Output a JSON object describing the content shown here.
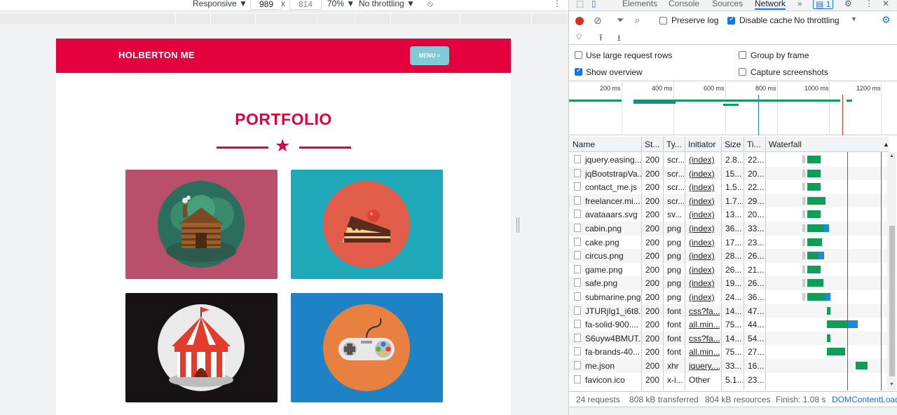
{
  "device_toolbar": {
    "device": "Responsive ▼",
    "width": "989",
    "times": "x",
    "height": "814",
    "zoom": "70% ▼",
    "throttle": "No throttling ▼"
  },
  "page": {
    "brand": "HOLBERTON ME",
    "menu": "MENU ≡",
    "section_title": "PORTFOLIO",
    "tiles": [
      {
        "name": "cabin",
        "color": "#b84f6b"
      },
      {
        "name": "cake",
        "color": "#1fa8b8"
      },
      {
        "name": "circus",
        "color": "#171314"
      },
      {
        "name": "game",
        "color": "#1d83c6"
      }
    ]
  },
  "devtools": {
    "tabs": [
      "Elements",
      "Console",
      "Sources",
      "Network"
    ],
    "active_tab": "Network",
    "more": "»",
    "issues_badge": "1",
    "toolbar": {
      "preserve_log": "Preserve log",
      "disable_cache": "Disable cache",
      "throttling": "No throttling"
    },
    "settings": {
      "large_rows": "Use large request rows",
      "group_by_frame": "Group by frame",
      "show_overview": "Show overview",
      "capture_screenshots": "Capture screenshots"
    },
    "overview_ticks": [
      "200 ms",
      "400 ms",
      "600 ms",
      "800 ms",
      "1000 ms",
      "1200 ms"
    ],
    "columns": [
      "Name",
      "St...",
      "Ty...",
      "Initiator",
      "Size",
      "Ti...",
      "Waterfall"
    ],
    "rows": [
      {
        "name": "jquery.easing....",
        "status": "200",
        "type": "scr...",
        "initiator": "(index)",
        "size": "2.8...",
        "time": "22...",
        "start": 0.16,
        "wait": 0.02,
        "recv": 0.12,
        "blue": 0.0
      },
      {
        "name": "jqBootstrapVa...",
        "status": "200",
        "type": "scr...",
        "initiator": "(index)",
        "size": "15...",
        "time": "20...",
        "start": 0.16,
        "wait": 0.02,
        "recv": 0.12,
        "blue": 0.0
      },
      {
        "name": "contact_me.js",
        "status": "200",
        "type": "scr...",
        "initiator": "(index)",
        "size": "1.5...",
        "time": "22...",
        "start": 0.16,
        "wait": 0.02,
        "recv": 0.12,
        "blue": 0.0
      },
      {
        "name": "freelancer.mi...",
        "status": "200",
        "type": "scr...",
        "initiator": "(index)",
        "size": "1.7...",
        "time": "29...",
        "start": 0.16,
        "wait": 0.02,
        "recv": 0.16,
        "blue": 0.0
      },
      {
        "name": "avataaars.svg",
        "status": "200",
        "type": "sv...",
        "initiator": "(index)",
        "size": "13...",
        "time": "20...",
        "start": 0.16,
        "wait": 0.02,
        "recv": 0.12,
        "blue": 0.0
      },
      {
        "name": "cabin.png",
        "status": "200",
        "type": "png",
        "initiator": "(index)",
        "size": "36...",
        "time": "33...",
        "start": 0.16,
        "wait": 0.02,
        "recv": 0.15,
        "blue": 0.04
      },
      {
        "name": "cake.png",
        "status": "200",
        "type": "png",
        "initiator": "(index)",
        "size": "17...",
        "time": "23...",
        "start": 0.16,
        "wait": 0.02,
        "recv": 0.13,
        "blue": 0.0
      },
      {
        "name": "circus.png",
        "status": "200",
        "type": "png",
        "initiator": "(index)",
        "size": "28...",
        "time": "26...",
        "start": 0.16,
        "wait": 0.02,
        "recv": 0.1,
        "blue": 0.05
      },
      {
        "name": "game.png",
        "status": "200",
        "type": "png",
        "initiator": "(index)",
        "size": "26...",
        "time": "21...",
        "start": 0.16,
        "wait": 0.02,
        "recv": 0.12,
        "blue": 0.0
      },
      {
        "name": "safe.png",
        "status": "200",
        "type": "png",
        "initiator": "(index)",
        "size": "19...",
        "time": "26...",
        "start": 0.16,
        "wait": 0.02,
        "recv": 0.14,
        "blue": 0.0
      },
      {
        "name": "submarine.png",
        "status": "200",
        "type": "png",
        "initiator": "(index)",
        "size": "24...",
        "time": "36...",
        "start": 0.16,
        "wait": 0.02,
        "recv": 0.16,
        "blue": 0.04
      },
      {
        "name": "JTURjIg1_i6t8...",
        "status": "200",
        "type": "font",
        "initiator": "css?fa...",
        "size": "14...",
        "time": "47...",
        "start": 0.35,
        "wait": 0.0,
        "recv": 0.03,
        "blue": 0.0
      },
      {
        "name": "fa-solid-900....",
        "status": "200",
        "type": "font",
        "initiator": "all.min...",
        "size": "75...",
        "time": "44...",
        "start": 0.35,
        "wait": 0.0,
        "recv": 0.18,
        "blue": 0.09
      },
      {
        "name": "S6uyw4BMUT...",
        "status": "200",
        "type": "font",
        "initiator": "css?fa...",
        "size": "14...",
        "time": "54...",
        "start": 0.35,
        "wait": 0.0,
        "recv": 0.03,
        "blue": 0.0
      },
      {
        "name": "fa-brands-40...",
        "status": "200",
        "type": "font",
        "initiator": "all.min...",
        "size": "75...",
        "time": "27...",
        "start": 0.35,
        "wait": 0.0,
        "recv": 0.16,
        "blue": 0.0
      },
      {
        "name": "me.json",
        "status": "200",
        "type": "xhr",
        "initiator": "jquery....",
        "size": "33...",
        "time": "16...",
        "start": 0.6,
        "wait": 0.0,
        "recv": 0.1,
        "blue": 0.0
      },
      {
        "name": "favicon.ico",
        "status": "200",
        "type": "x-i...",
        "initiator": "Other",
        "size": "5.1...",
        "time": "23...",
        "start": 0.0,
        "wait": 0.0,
        "recv": 0.0,
        "blue": 0.0
      }
    ],
    "status": {
      "requests": "24 requests",
      "transferred": "808 kB transferred",
      "resources": "804 kB resources",
      "finish": "Finish: 1.08 s",
      "dcl": "DOMContentLoad"
    }
  }
}
